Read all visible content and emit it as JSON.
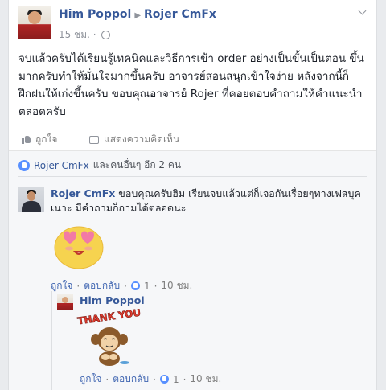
{
  "post": {
    "author": "Him Poppol",
    "target": "Rojer CmFx",
    "time": "15 ชม.",
    "text": "จบแล้วครับได้เรียนรู้เทคนิคและวิธีการเข้า order อย่างเป็นขั้นเป็นตอน ขึ้นมากครับทำให้มั่นใจมากขึ้นครับ อาจารย์สอนสนุกเข้าใจง่าย หลังจากนี้ก็ฝึกฝนให้เก่งขึ้นครับ ขอบคุณอาจารย์ Rojer ที่คอยตอบคำถามให้คำแนะนำตลอดครับ"
  },
  "actions": {
    "like_label": "ถูกใจ",
    "comment_label": "แสดงความคิดเห็น"
  },
  "likes_summary": {
    "name": "Rojer CmFx",
    "rest": "และคนอื่นๆ อีก 2 คน"
  },
  "comments": [
    {
      "author": "Rojer CmFx",
      "text": "ขอบคุณครับฮิม เรียนจบแล้วแต่ก็เจอกันเรื่อยๆทางเฟสบุคเนาะ มีคำถามก็ถามได้ตลอดนะ",
      "sticker": "heart-eyes-emoji-sticker",
      "like_label": "ถูกใจ",
      "reply_label": "ตอบกลับ",
      "like_count": "1",
      "time": "10 ชม.",
      "sep": "·"
    },
    {
      "author": "Him Poppol",
      "sticker": "thank-you-monkey-sticker",
      "sticker_text": "THANK YOU",
      "like_label": "ถูกใจ",
      "reply_label": "ตอบกลับ",
      "like_count": "1",
      "time": "10 ชม.",
      "sep": "·"
    }
  ],
  "colors": {
    "link": "#365899",
    "background": "#e9ebee",
    "muted": "#90949c",
    "like_blue": "#5890ff"
  }
}
